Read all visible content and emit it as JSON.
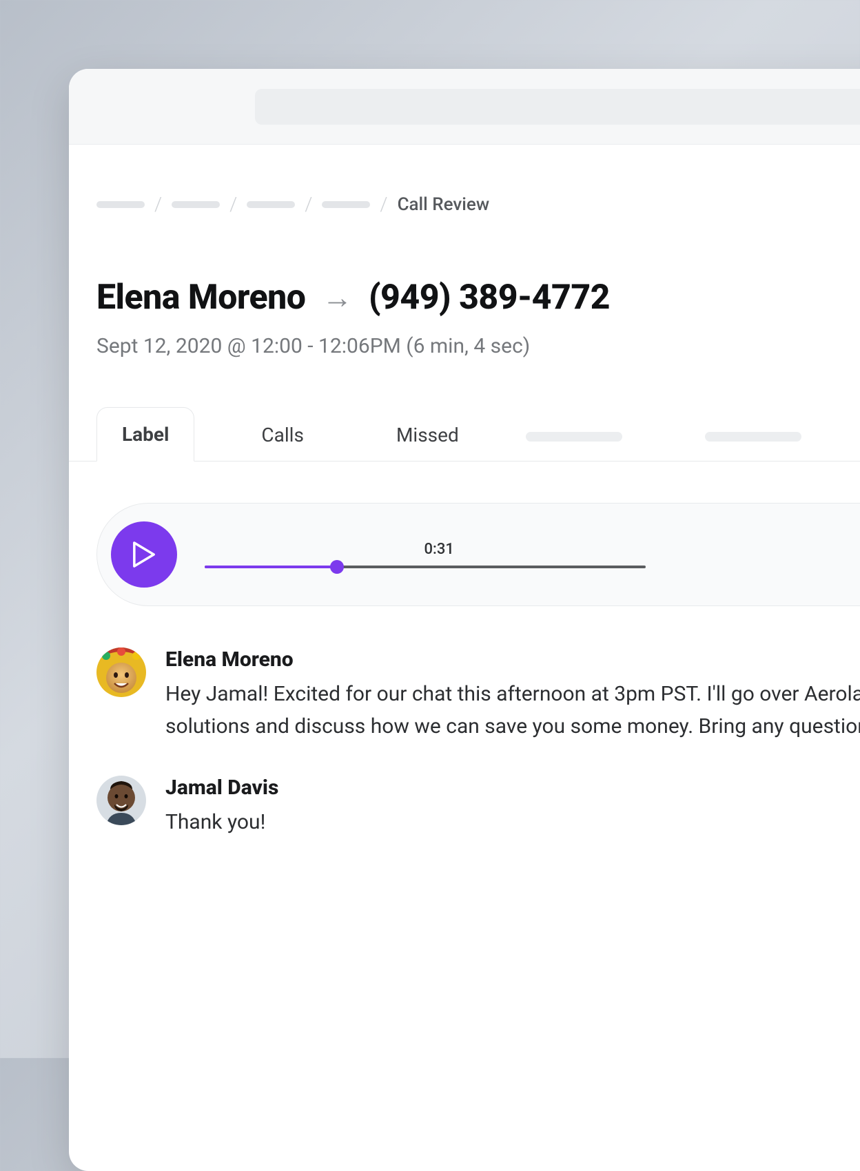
{
  "breadcrumb": {
    "current": "Call Review"
  },
  "call": {
    "caller": "Elena Moreno",
    "callee": "(949) 389-4772",
    "meta": "Sept 12, 2020 @ 12:00 - 12:06PM (6 min, 4 sec)"
  },
  "tabs": {
    "items": [
      {
        "label": "Label",
        "active": true
      },
      {
        "label": "Calls",
        "active": false
      },
      {
        "label": "Missed",
        "active": false
      }
    ]
  },
  "player": {
    "elapsed": "0:31",
    "progress_pct": 30
  },
  "transcript": [
    {
      "speaker": "Elena Moreno",
      "text": "Hey Jamal! Excited for our chat this afternoon at 3pm PST. I'll go over Aerolabs' insurance solutions and discuss how we can save you some money. Bring any questions you have!"
    },
    {
      "speaker": "Jamal Davis",
      "text": "Thank you!"
    }
  ],
  "colors": {
    "accent": "#7c3aed"
  }
}
